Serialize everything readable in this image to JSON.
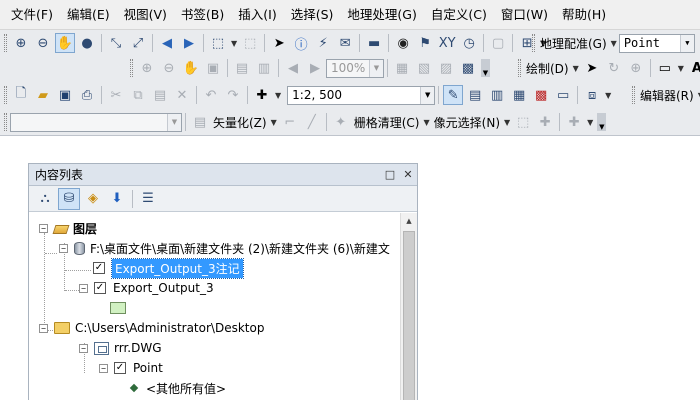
{
  "menu": [
    "文件(F)",
    "编辑(E)",
    "视图(V)",
    "书签(B)",
    "插入(I)",
    "选择(S)",
    "地理处理(G)",
    "自定义(C)",
    "窗口(W)",
    "帮助(H)"
  ],
  "toolbar": {
    "georef_label": "地理配准(G)",
    "georef_layer_value": "Point",
    "zoom_percent_value": "100%",
    "draw_label": "绘制(D)",
    "scale_value": "1:2, 500",
    "editor_label": "编辑器(R)",
    "vectorize_label": "矢量化(Z)",
    "raster_cleanup_label": "栅格清理(C)",
    "cell_select_label": "像元选择(N)",
    "target_combo_value": ""
  },
  "toc": {
    "title": "内容列表",
    "pin_icon": "□",
    "close_icon": "✕",
    "layers_root": "图层",
    "gdb_path": "F:\\桌面文件\\桌面\\新建文件夹 (2)\\新建文件夹 (6)\\新建文",
    "layer_annotation": "Export_Output_3注记",
    "layer_output": "Export_Output_3",
    "desktop_path": "C:\\Users\\Administrator\\Desktop",
    "dwg_name": "rrr.DWG",
    "point_layer": "Point",
    "other_values": "<其他所有值>"
  },
  "colors": {
    "selection": "#3399ff",
    "polygon_fill": "#d1f1c2",
    "toolbar_bg": "#e9ebee"
  }
}
